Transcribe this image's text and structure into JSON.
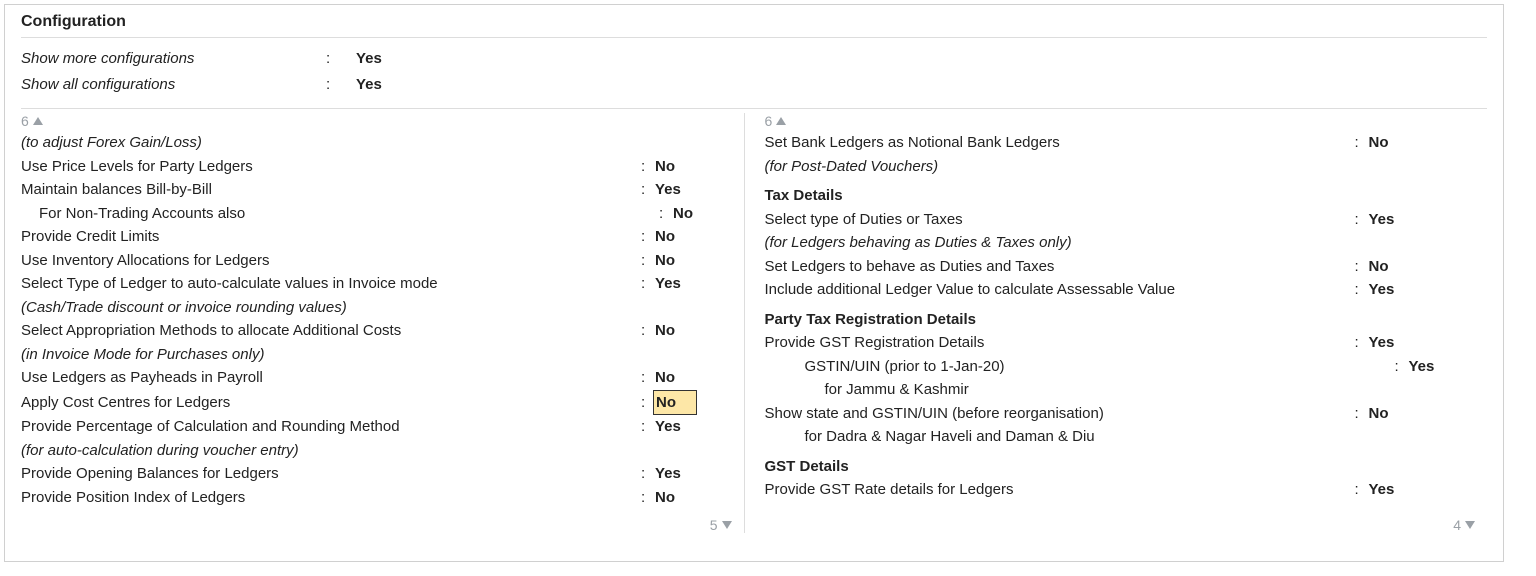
{
  "heading": "Configuration",
  "top": {
    "show_more_label": "Show more configurations",
    "show_more_value": "Yes",
    "show_all_label": "Show all configurations",
    "show_all_value": "Yes",
    "sep": ":"
  },
  "left": {
    "page_top": "6",
    "page_bottom": "5",
    "lines": {
      "note_forex": "(to adjust Forex Gain/Loss)",
      "price_levels_label": "Use Price Levels for Party Ledgers",
      "price_levels_value": "No",
      "bill_by_bill_label": "Maintain balances Bill-by-Bill",
      "bill_by_bill_value": "Yes",
      "non_trading_label": "For Non-Trading Accounts also",
      "non_trading_value": "No",
      "credit_limits_label": "Provide Credit Limits",
      "credit_limits_value": "No",
      "inv_alloc_label": "Use Inventory Allocations for Ledgers",
      "inv_alloc_value": "No",
      "auto_calc_label": "Select Type of Ledger to auto-calculate values in Invoice mode",
      "auto_calc_value": "Yes",
      "auto_calc_note": "(Cash/Trade discount or invoice rounding values)",
      "approp_methods_label": "Select Appropriation Methods to allocate Additional Costs",
      "approp_methods_value": "No",
      "approp_note": "(in Invoice Mode for Purchases only)",
      "payheads_label": "Use Ledgers as Payheads in Payroll",
      "payheads_value": "No",
      "cost_centres_label": "Apply Cost Centres for Ledgers",
      "cost_centres_value": "No",
      "pct_round_label": "Provide Percentage of Calculation and Rounding Method",
      "pct_round_value": "Yes",
      "pct_round_note": "(for auto-calculation during voucher entry)",
      "opening_bal_label": "Provide Opening Balances for Ledgers",
      "opening_bal_value": "Yes",
      "pos_index_label": "Provide Position Index of Ledgers",
      "pos_index_value": "No"
    }
  },
  "right": {
    "page_top": "6",
    "page_bottom": "4",
    "lines": {
      "notional_bank_label": "Set Bank Ledgers as Notional Bank Ledgers",
      "notional_bank_value": "No",
      "pdc_note": "(for Post-Dated Vouchers)",
      "tax_details_heading": "Tax Details",
      "select_duties_label": "Select type of Duties or Taxes",
      "select_duties_value": "Yes",
      "duties_note": "(for Ledgers behaving as Duties & Taxes only)",
      "behave_duties_label": "Set Ledgers to behave as Duties and Taxes",
      "behave_duties_value": "No",
      "include_addl_label": "Include additional Ledger Value to calculate Assessable Value",
      "include_addl_value": "Yes",
      "party_tax_heading": "Party Tax Registration Details",
      "gst_reg_label": "Provide GST Registration Details",
      "gst_reg_value": "Yes",
      "gstin_prior_label": "GSTIN/UIN (prior to 1-Jan-20)",
      "gstin_prior_value": "Yes",
      "gstin_prior_note": "for Jammu & Kashmir",
      "show_state_label": "Show state and GSTIN/UIN (before reorganisation)",
      "show_state_value": "No",
      "show_state_note": "for Dadra & Nagar Haveli and Daman & Diu",
      "gst_details_heading": "GST Details",
      "gst_rate_label": "Provide GST Rate details for Ledgers",
      "gst_rate_value": "Yes"
    }
  }
}
